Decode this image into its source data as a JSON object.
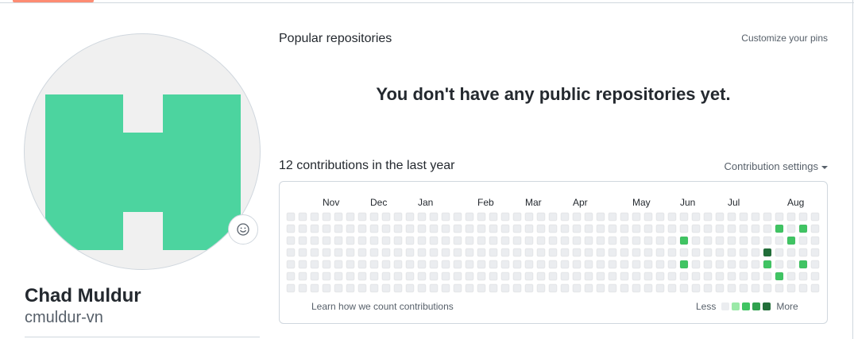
{
  "profile": {
    "name": "Chad Muldur",
    "username": "cmuldur-vn",
    "avatar_letter_color": "#4cd49f",
    "status_icon": "smiley-icon"
  },
  "pinned": {
    "title": "Popular repositories",
    "customize_label": "Customize your pins",
    "empty_message": "You don't have any public repositories yet."
  },
  "contributions": {
    "title": "12 contributions in the last year",
    "settings_label": "Contribution settings",
    "learn_label": "Learn how we count contributions",
    "legend": {
      "less_label": "Less",
      "more_label": "More",
      "colors": [
        "#ebedf0",
        "#9be9a8",
        "#40c463",
        "#30a14e",
        "#216e39"
      ]
    },
    "months": [
      {
        "label": "Nov",
        "week": 3
      },
      {
        "label": "Dec",
        "week": 7
      },
      {
        "label": "Jan",
        "week": 11
      },
      {
        "label": "Feb",
        "week": 16
      },
      {
        "label": "Mar",
        "week": 20
      },
      {
        "label": "Apr",
        "week": 24
      },
      {
        "label": "May",
        "week": 29
      },
      {
        "label": "Jun",
        "week": 33
      },
      {
        "label": "Jul",
        "week": 37
      },
      {
        "label": "Aug",
        "week": 42
      }
    ],
    "weeks": 45,
    "active_days": [
      {
        "week": 33,
        "day": 2,
        "level": 2
      },
      {
        "week": 33,
        "day": 4,
        "level": 2
      },
      {
        "week": 40,
        "day": 3,
        "level": 4
      },
      {
        "week": 40,
        "day": 4,
        "level": 2
      },
      {
        "week": 41,
        "day": 1,
        "level": 2
      },
      {
        "week": 41,
        "day": 5,
        "level": 2
      },
      {
        "week": 42,
        "day": 2,
        "level": 2
      },
      {
        "week": 43,
        "day": 1,
        "level": 2
      },
      {
        "week": 43,
        "day": 4,
        "level": 2
      }
    ]
  }
}
